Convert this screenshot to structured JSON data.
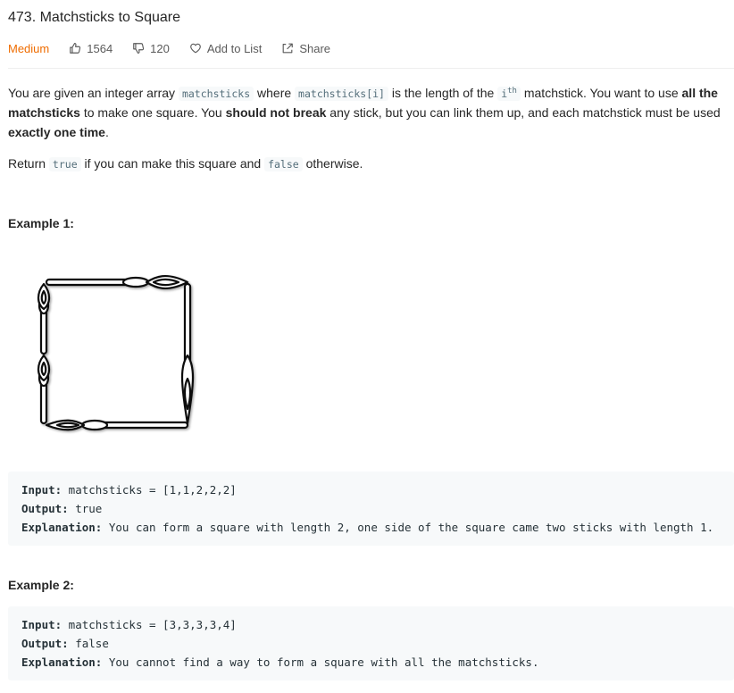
{
  "problem": {
    "title": "473. Matchsticks to Square",
    "difficulty": "Medium",
    "likes": "1564",
    "dislikes": "120",
    "add_to_list": "Add to List",
    "share": "Share"
  },
  "description": {
    "p1": {
      "t1": "You are given an integer array ",
      "c1": "matchsticks",
      "t2": " where ",
      "c2": "matchsticks[i]",
      "t3": " is the length of the ",
      "c3_base": "i",
      "c3_sup": "th",
      "t4": " matchstick. You want to use ",
      "b1": "all the matchsticks",
      "t5": " to make one square. You ",
      "b2": "should not break",
      "t6": " any stick, but you can link them up, and each matchstick must be used ",
      "b3": "exactly one time",
      "t7": "."
    },
    "p2": {
      "t1": "Return ",
      "c1": "true",
      "t2": " if you can make this square and ",
      "c2": "false",
      "t3": " otherwise."
    }
  },
  "examples": [
    {
      "title": "Example 1:",
      "input_label": "Input:",
      "input_value": " matchsticks = [1,1,2,2,2]",
      "output_label": "Output:",
      "output_value": " true",
      "explanation_label": "Explanation:",
      "explanation_value": " You can form a square with length 2, one side of the square came two sticks with length 1."
    },
    {
      "title": "Example 2:",
      "input_label": "Input:",
      "input_value": " matchsticks = [3,3,3,3,4]",
      "output_label": "Output:",
      "output_value": " false",
      "explanation_label": "Explanation:",
      "explanation_value": " You cannot find a way to form a square with all the matchsticks."
    }
  ],
  "colors": {
    "difficulty_medium": "#ef6c00",
    "code_bg": "#f7f9fa",
    "inline_code_text": "#546e7a"
  },
  "icons": [
    "thumbs-up-icon",
    "thumbs-down-icon",
    "heart-icon",
    "share-icon"
  ]
}
